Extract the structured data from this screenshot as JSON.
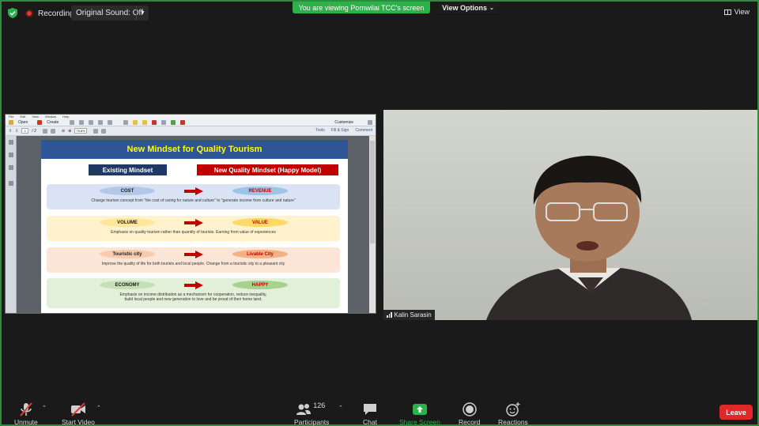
{
  "topbar": {
    "recording_label": "Recording",
    "original_sound_label": "Original Sound: Off",
    "viewing_banner": "You are viewing Pornwilai TCC's screen",
    "view_options_label": "View Options",
    "view_label": "View"
  },
  "viewer": {
    "menu": [
      "File",
      "Edit",
      "View",
      "Window",
      "Help"
    ],
    "open_label": "Open",
    "create_label": "Create",
    "customize_label": "Customize",
    "page_current": "1",
    "page_total": "/ 2",
    "zoom": "75.8%",
    "tools_label": "Tools",
    "fill_sign_label": "Fill & Sign",
    "comment_label": "Comment"
  },
  "slide": {
    "title": "New Mindset for Quality Tourism",
    "existing_header": "Existing Mindset",
    "new_header": "New Quality Mindset (Happy Model)",
    "rows": [
      {
        "left": "COST",
        "right": "REVENUE",
        "desc": "Change tourism concept from \"the cost of caring for nature and culture\" to \"generate income from culture and nature\"",
        "bg": "#dae3f3",
        "left_bg": "#b4c7e7",
        "right_bg": "#9dc3e6",
        "right_color": "#c00000"
      },
      {
        "left": "VOLUME",
        "right": "VALUE",
        "desc": "Emphasis on quality tourism rather than quantity of tourists.  Earning from value of experiences",
        "bg": "#fff2cc",
        "left_bg": "#ffe699",
        "right_bg": "#ffd966",
        "right_color": "#c00000"
      },
      {
        "left": "Touristic city",
        "right": "Livable City",
        "desc": "Improve the quality of life for both tourists and local people.  Change from a touristic city to a pleasant city",
        "bg": "#fbe5d6",
        "left_bg": "#f8cbad",
        "right_bg": "#f4b183",
        "right_color": "#c00000"
      },
      {
        "left": "ECONOMY",
        "right": "HAPPY",
        "desc1": "Emphasis on income distribution as a mechanism for cooperation, reduce inequality,",
        "desc2": "build local people and new generation to love and be proud of their home land.",
        "bg": "#e2f0d9",
        "left_bg": "#c5e0b4",
        "right_bg": "#a9d18e",
        "right_color": "#c00000"
      }
    ],
    "arrow_color": "#c00000"
  },
  "video": {
    "participant_name": "Kalin Sarasin"
  },
  "bottombar": {
    "unmute_label": "Unmute",
    "start_video_label": "Start Video",
    "participants_label": "Participants",
    "participants_count": "126",
    "chat_label": "Chat",
    "share_screen_label": "Share Screen",
    "record_label": "Record",
    "reactions_label": "Reactions",
    "leave_label": "Leave"
  },
  "colors": {
    "accent_green": "#2db14b",
    "leave_red": "#e02828",
    "record_red": "#e03b2f"
  }
}
